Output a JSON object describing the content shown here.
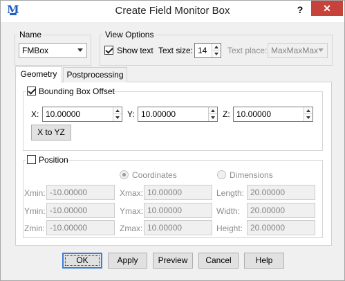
{
  "window": {
    "title": "Create Field Monitor Box",
    "help_label": "?",
    "close_label": "✕",
    "app_icon": "M"
  },
  "name_group": {
    "label": "Name",
    "value": "FMBox"
  },
  "view_options": {
    "label": "View Options",
    "show_text_label": "Show text",
    "show_text_checked": true,
    "text_size_label": "Text size:",
    "text_size_value": "14",
    "text_place_label": "Text place:",
    "text_place_value": "MaxMaxMax"
  },
  "tabs": [
    {
      "label": "Geometry",
      "active": true
    },
    {
      "label": "Postprocessing",
      "active": false
    }
  ],
  "bounding_box": {
    "label": "Bounding Box Offset",
    "checked": true,
    "x_label": "X:",
    "x_value": "10.00000",
    "y_label": "Y:",
    "y_value": "10.00000",
    "z_label": "Z:",
    "z_value": "10.00000",
    "x_to_yz_label": "X to YZ"
  },
  "position": {
    "label": "Position",
    "checked": false,
    "coordinates_label": "Coordinates",
    "dimensions_label": "Dimensions",
    "xmin_label": "Xmin:",
    "xmin_value": "-10.00000",
    "ymin_label": "Ymin:",
    "ymin_value": "-10.00000",
    "zmin_label": "Zmin:",
    "zmin_value": "-10.00000",
    "xmax_label": "Xmax:",
    "xmax_value": "10.00000",
    "ymax_label": "Ymax:",
    "ymax_value": "10.00000",
    "zmax_label": "Zmax:",
    "zmax_value": "10.00000",
    "length_label": "Length:",
    "length_value": "20.00000",
    "width_label": "Width:",
    "width_value": "20.00000",
    "height_label": "Height:",
    "height_value": "20.00000"
  },
  "buttons": {
    "ok": "OK",
    "apply": "Apply",
    "preview": "Preview",
    "cancel": "Cancel",
    "help": "Help"
  },
  "colors": {
    "accent": "#3c7fd6",
    "close": "#c7423a",
    "app_icon": "#1f5fbf"
  }
}
